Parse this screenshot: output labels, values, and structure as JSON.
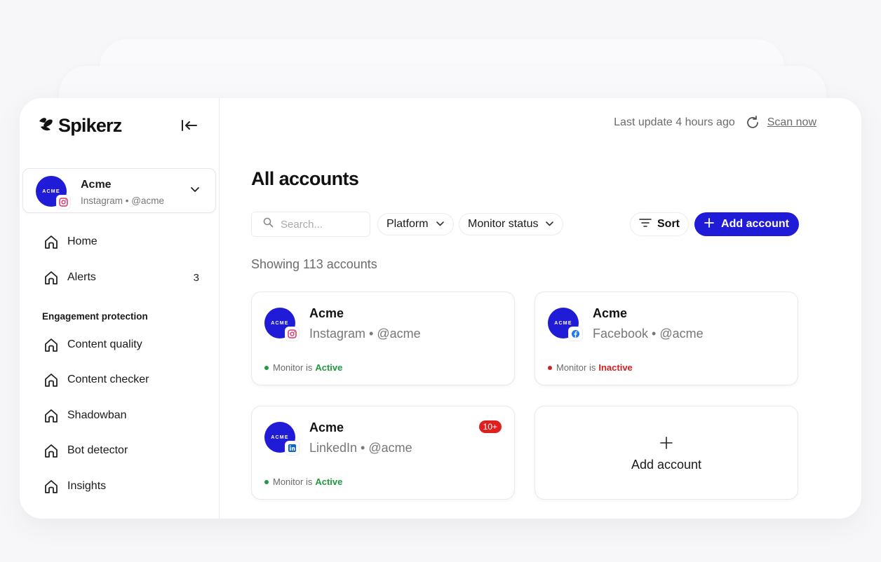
{
  "app": {
    "brand": "Spikerz"
  },
  "sidebar": {
    "account": {
      "avatar_text": "ACME",
      "name": "Acme",
      "subtitle": "Instagram • @acme",
      "platform_icon": "instagram-icon"
    },
    "items": [
      {
        "label": "Home",
        "icon": "home-icon"
      },
      {
        "label": "Alerts",
        "icon": "home-icon",
        "count": "3"
      }
    ],
    "section_title": "Engagement protection",
    "section_items": [
      {
        "label": "Content quality",
        "icon": "home-icon"
      },
      {
        "label": "Content checker",
        "icon": "home-icon"
      },
      {
        "label": "Shadowban",
        "icon": "home-icon"
      },
      {
        "label": "Bot detector",
        "icon": "home-icon"
      },
      {
        "label": "Insights",
        "icon": "home-icon"
      }
    ]
  },
  "header": {
    "last_update": "Last update 4 hours ago",
    "scan_label": "Scan now"
  },
  "main": {
    "title": "All accounts",
    "search_placeholder": "Search...",
    "filters": {
      "platform": "Platform",
      "monitor_status": "Monitor status"
    },
    "sort_label": "Sort",
    "add_account_label": "Add account",
    "showing": "Showing 113 accounts",
    "accounts": [
      {
        "avatar_text": "ACME",
        "name": "Acme",
        "subtitle": "Instagram • @acme",
        "platform_icon": "instagram-icon",
        "status_prefix": "Monitor is",
        "status": "Active",
        "status_color": "#1f9a3e"
      },
      {
        "avatar_text": "ACME",
        "name": "Acme",
        "subtitle": "Facebook • @acme",
        "platform_icon": "facebook-icon",
        "status_prefix": "Monitor is",
        "status": "Inactive",
        "status_color": "#d11f1f"
      },
      {
        "avatar_text": "ACME",
        "name": "Acme",
        "subtitle": "LinkedIn • @acme",
        "platform_icon": "linkedin-icon",
        "status_prefix": "Monitor is",
        "status": "Active",
        "status_color": "#1f9a3e",
        "badge": "10+"
      }
    ],
    "add_card_label": "Add account"
  },
  "colors": {
    "brand": "#1f1bd6",
    "active": "#1f9a3e",
    "inactive": "#d11f1f",
    "alert_badge": "#e0201f"
  }
}
